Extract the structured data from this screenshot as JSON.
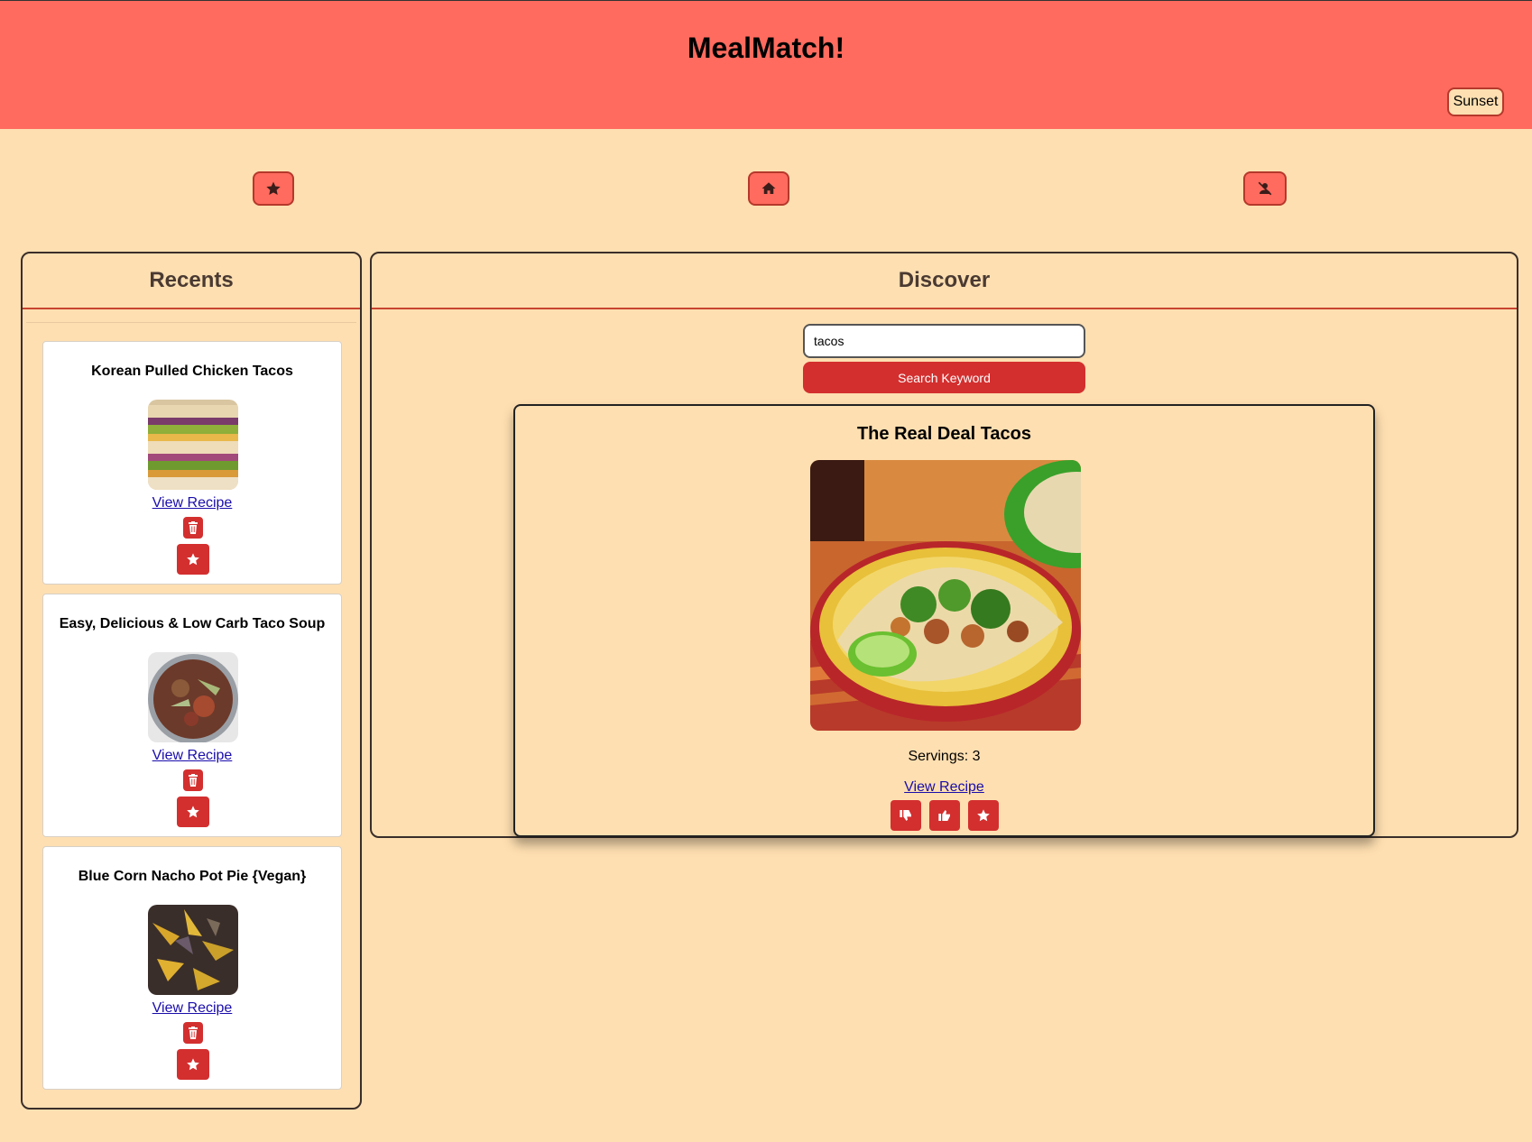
{
  "app": {
    "title": "MealMatch!",
    "theme_button": "Sunset"
  },
  "nav": {
    "items": [
      {
        "icon": "star-icon"
      },
      {
        "icon": "home-icon"
      },
      {
        "icon": "user-slash-icon"
      }
    ]
  },
  "recents": {
    "heading": "Recents",
    "items": [
      {
        "title": "Korean Pulled Chicken Tacos",
        "link": "View Recipe"
      },
      {
        "title": "Easy, Delicious & Low Carb Taco Soup",
        "link": "View Recipe"
      },
      {
        "title": "Blue Corn Nacho Pot Pie {Vegan}",
        "link": "View Recipe"
      }
    ]
  },
  "discover": {
    "heading": "Discover",
    "search": {
      "value": "tacos",
      "button": "Search Keyword"
    },
    "card": {
      "title": "The Real Deal Tacos",
      "servings": "Servings: 3",
      "link": "View Recipe"
    }
  },
  "colors": {
    "background": "#fedfb1",
    "header": "#ff6b5e",
    "accent_red": "#d32f2f"
  }
}
